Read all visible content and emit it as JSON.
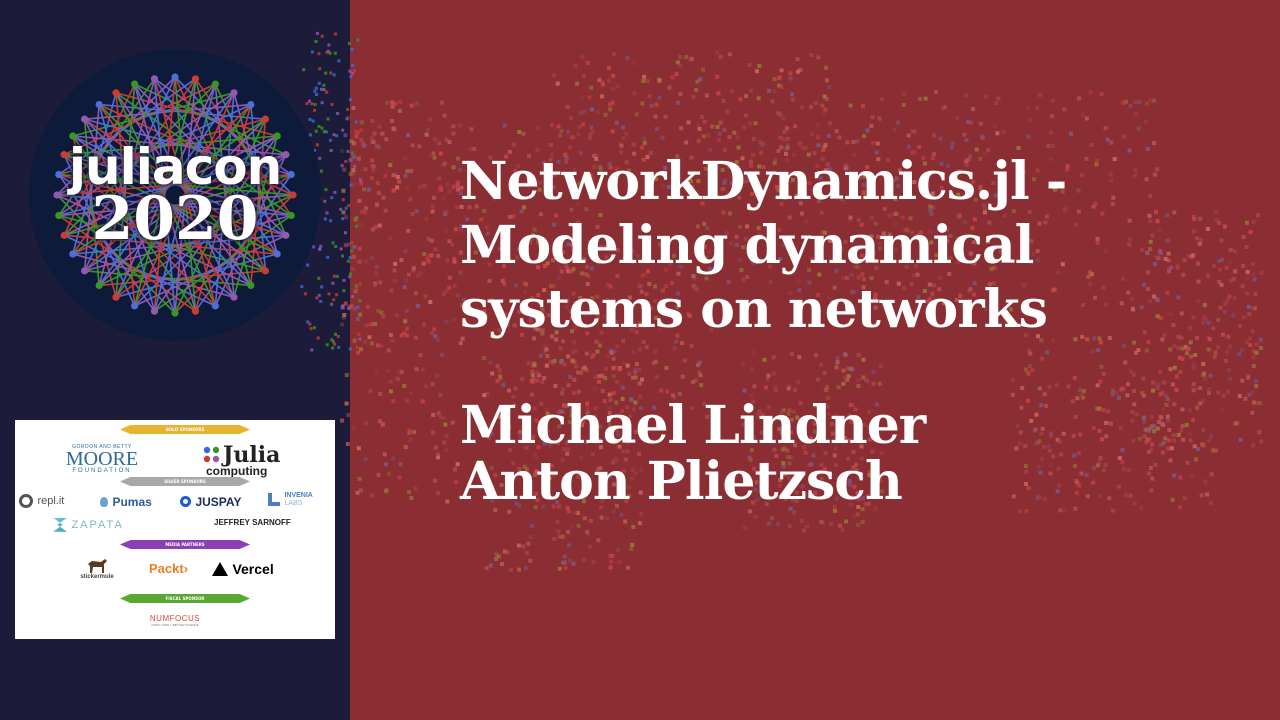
{
  "logo": {
    "word": "juliacon",
    "year": "2020"
  },
  "title_lines": [
    "NetworkDynamics.jl -",
    "Modeling dynamical",
    "systems on networks"
  ],
  "authors": [
    "Michael Lindner",
    "Anton Plietzsch"
  ],
  "sponsors": {
    "gold_label": "GOLD SPONSORS",
    "silver_label": "SILVER SPONSORS",
    "media_label": "MEDIA PARTNERS",
    "fiscal_label": "FISCAL SPONSOR",
    "moore_top": "GORDON AND BETTY",
    "moore_mid": "MOORE",
    "moore_bottom": "FOUNDATION",
    "julia_name": "Julia",
    "julia_sub": "computing",
    "replit": "repl.it",
    "pumas": "Pumas",
    "juspay": "JUSPAY",
    "invenia": "INVENIA",
    "invenia_sub": "LABS",
    "zapata": "ZAPATA",
    "sarnoff": "JEFFREY SARNOFF",
    "stickermule": "stickermule",
    "packt": "Packt›",
    "vercel": "Vercel",
    "numfocus": "NUMFOCUS",
    "numfocus_sub": "OPEN CODE = BETTER SCIENCE"
  },
  "colors": {
    "left_bg": "#1c1b3a",
    "right_bg": "#8a2e33",
    "gold": "#e9b332",
    "silver": "#a8a8a8",
    "media": "#8a3fb5",
    "fiscal": "#5aa832"
  }
}
